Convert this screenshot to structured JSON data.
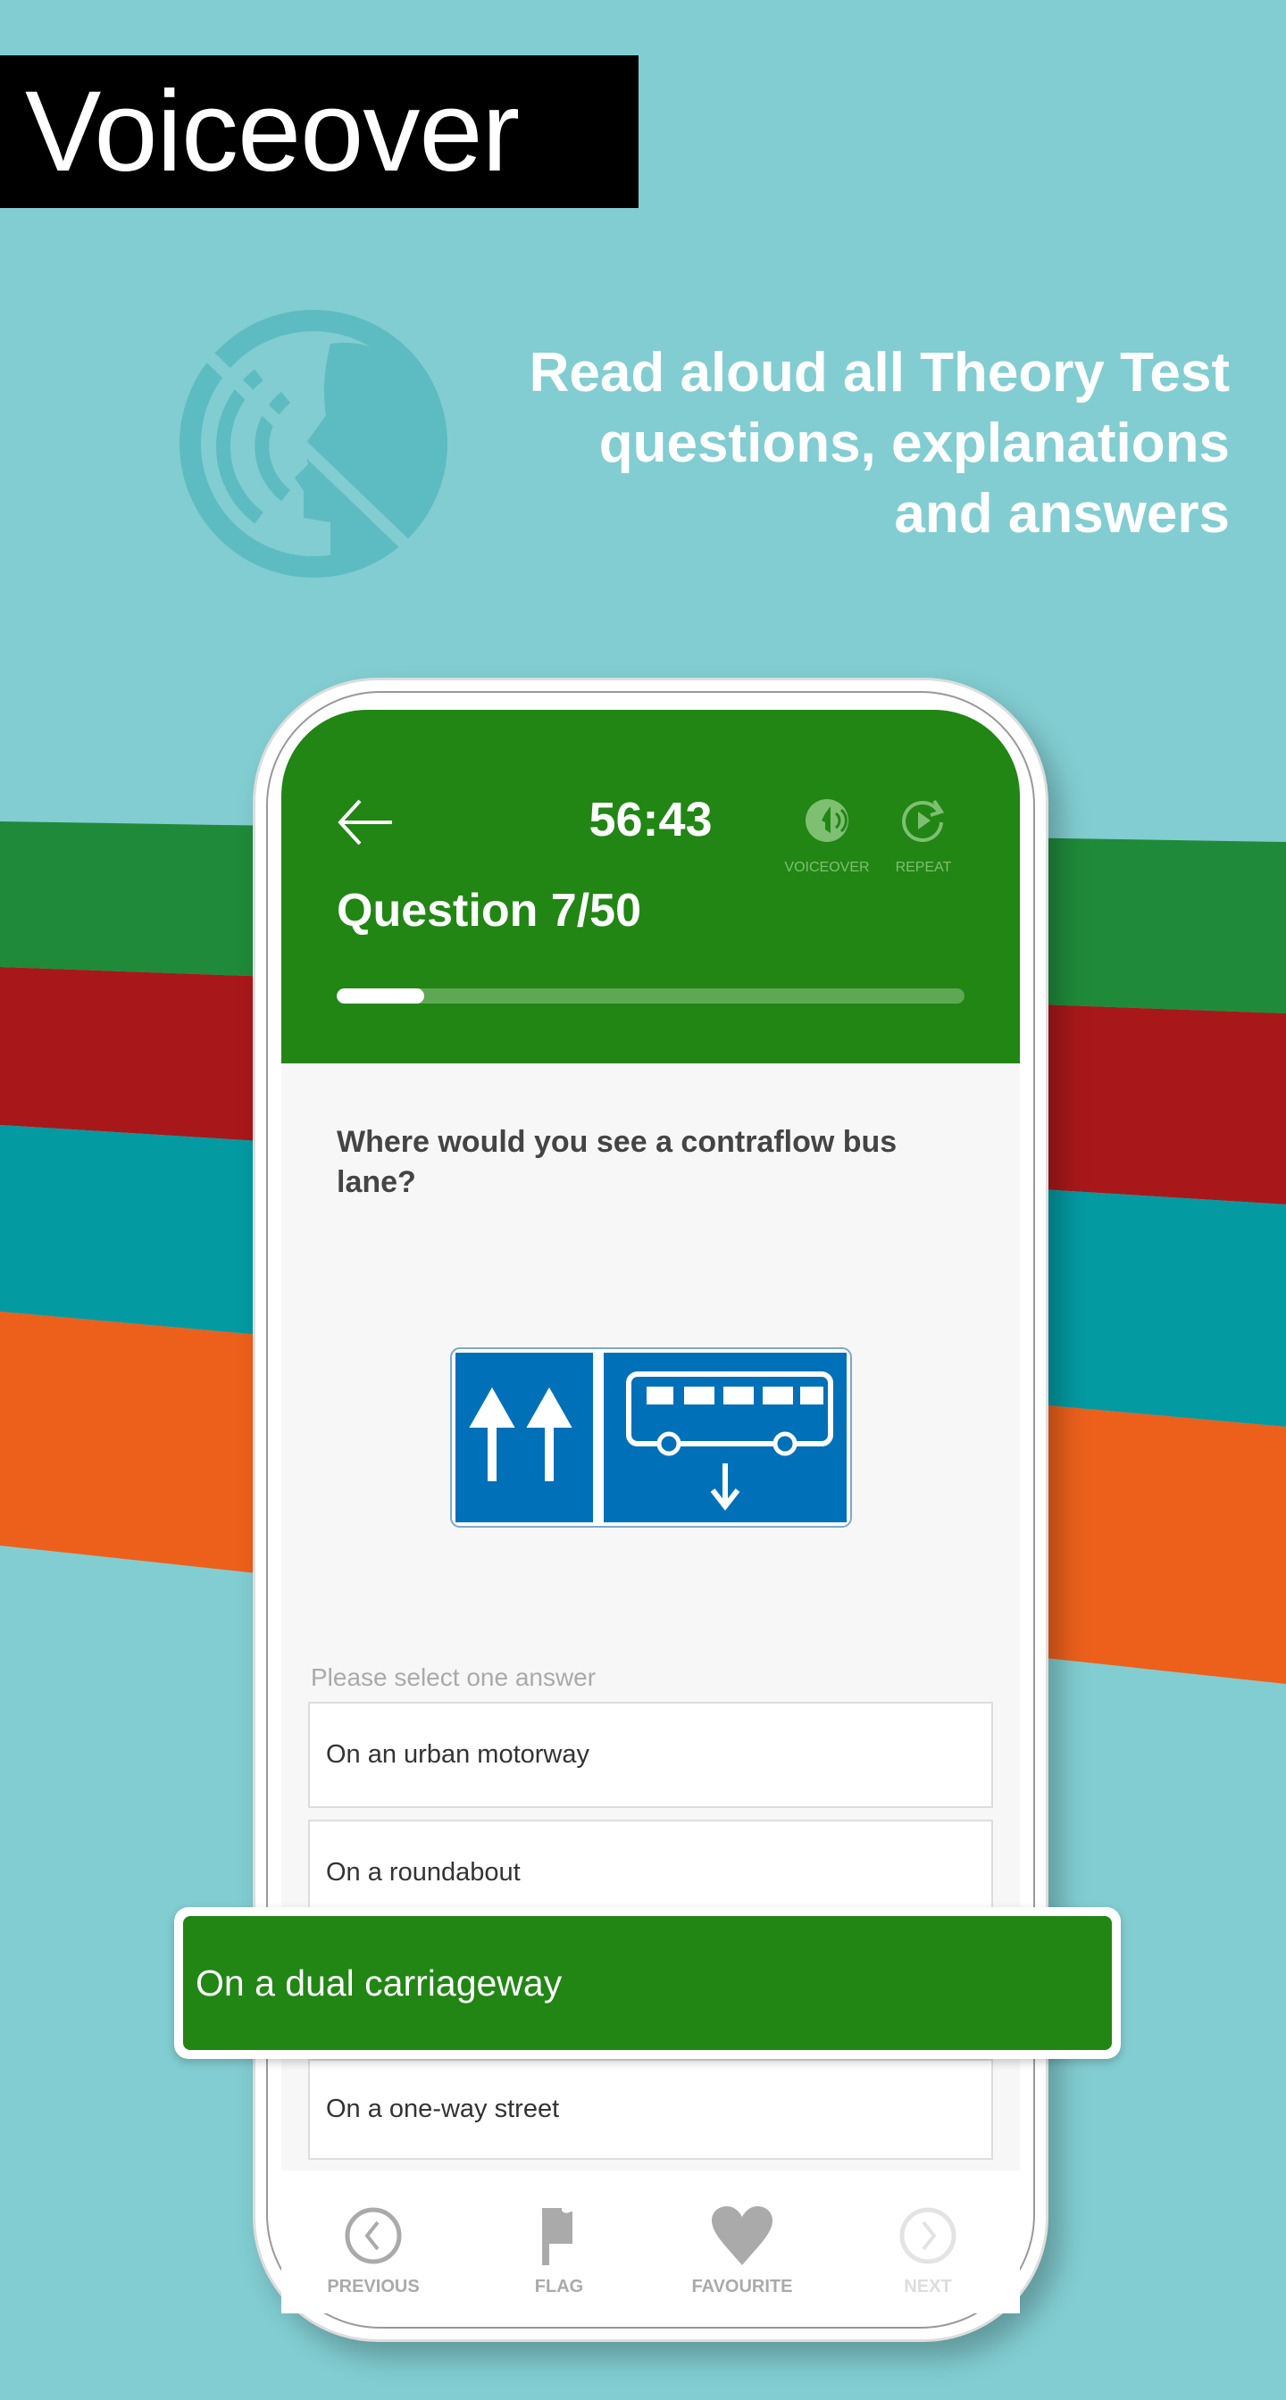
{
  "promo": {
    "title": "Voiceover",
    "tagline_lines": [
      "Read aloud all Theory Test",
      "questions, explanations",
      "and answers"
    ],
    "colors": {
      "background": "#82cdd1",
      "stripe_green": "#1f8a3a",
      "stripe_red": "#a8181a",
      "stripe_teal": "#049aa2",
      "stripe_orange": "#ec601c"
    }
  },
  "header": {
    "back_icon": "arrow-left-icon",
    "timer": "56:43",
    "voiceover_label": "VOICEOVER",
    "repeat_label": "REPEAT",
    "question_counter": "Question 7/50",
    "progress_fraction": 0.14,
    "color": "#218614"
  },
  "question": {
    "text": "Where would you see a contraflow bus lane?",
    "sign": "contraflow-bus-lane-sign",
    "hint": "Please select one answer",
    "answers": [
      "On an urban motorway",
      "On a roundabout",
      "On a dual carriageway",
      "On a one-way street"
    ],
    "selected_index": 2
  },
  "nav": {
    "previous": "PREVIOUS",
    "flag": "FLAG",
    "favourite": "FAVOURITE",
    "next": "NEXT"
  }
}
